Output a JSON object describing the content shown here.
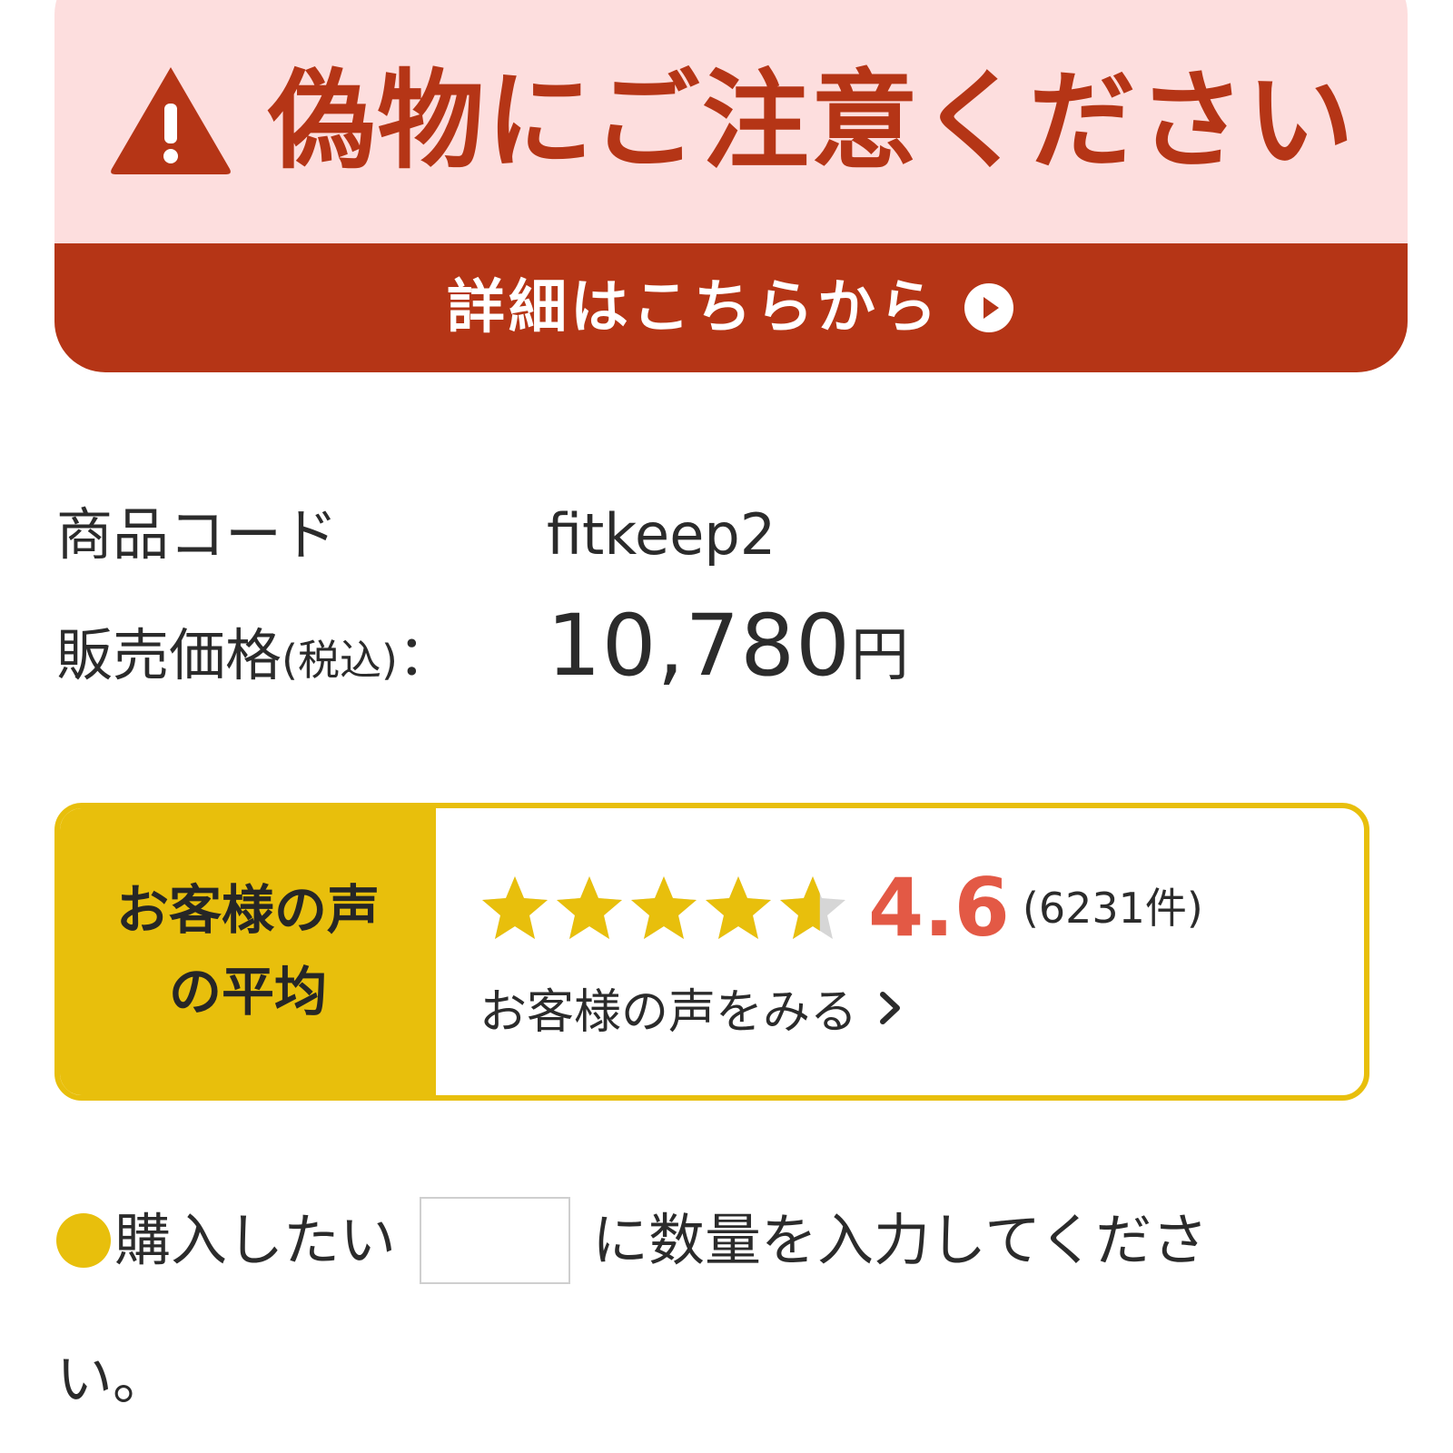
{
  "warning": {
    "title": "偽物にご注意ください",
    "icon": "warning-triangle-icon",
    "link_label": "詳細はこちらから",
    "link_icon": "play-circle-icon",
    "colors": {
      "background_top": "#fddede",
      "accent": "#b53516"
    }
  },
  "product": {
    "code_label": "商品コード",
    "code_value": "fitkeep2",
    "price_label": "販売価格",
    "price_tax_note": "(税込)",
    "price_colon": "：",
    "price_amount": "10,780",
    "price_currency": "円"
  },
  "reviews": {
    "label_line1": "お客様の声",
    "label_line2": "の平均",
    "rating": 4.6,
    "rating_text": "4.6",
    "max_stars": 5,
    "count_text": "(6231件)",
    "link_label": "お客様の声をみる",
    "link_icon": "chevron-right-icon",
    "colors": {
      "accent": "#e8bf0c",
      "score": "#e35945",
      "star_empty": "#d6d6d6"
    }
  },
  "purchase": {
    "bullet_color": "#e8bf0c",
    "prefix": "購入したい",
    "quantity_value": "",
    "suffix": "に数量を入力してくださ",
    "tail": "い。"
  }
}
